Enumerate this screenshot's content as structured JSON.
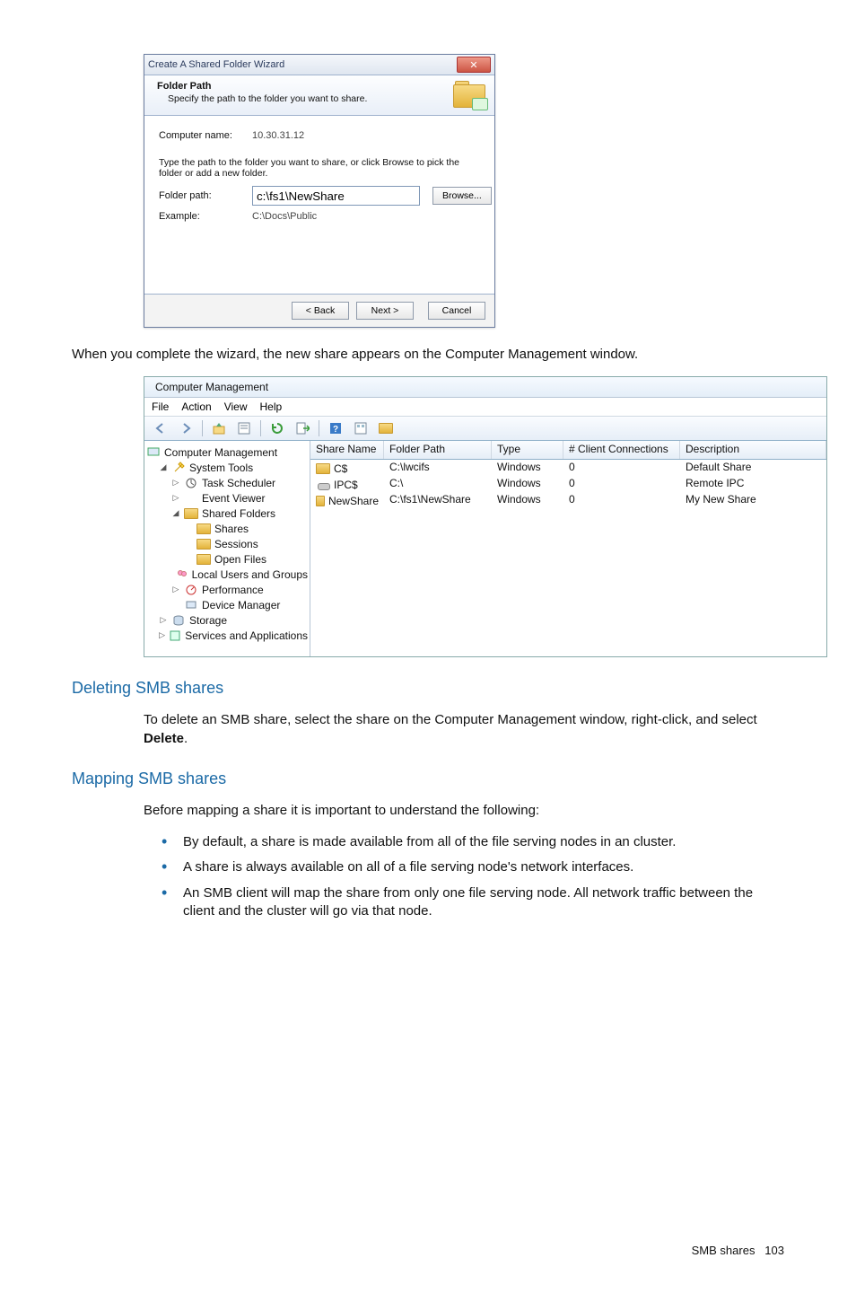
{
  "wizard": {
    "title": "Create A Shared Folder Wizard",
    "header_title": "Folder Path",
    "header_sub": "Specify the path to the folder you want to share.",
    "computer_label": "Computer name:",
    "computer_value": "10.30.31.12",
    "help": "Type the path to the folder you want to share, or click Browse to pick the folder or add a new folder.",
    "path_label": "Folder path:",
    "path_value": "c:\\fs1\\NewShare",
    "browse": "Browse...",
    "example_label": "Example:",
    "example_value": "C:\\Docs\\Public",
    "back": "< Back",
    "next": "Next >",
    "cancel": "Cancel"
  },
  "para_after_wizard": "When you complete the wizard, the new share appears on the Computer Management window.",
  "mgmt": {
    "title": "Computer Management",
    "menus": [
      "File",
      "Action",
      "View",
      "Help"
    ],
    "tree": {
      "root": "Computer Management",
      "system_tools": "System Tools",
      "task_scheduler": "Task Scheduler",
      "event_viewer": "Event Viewer",
      "shared_folders": "Shared Folders",
      "shares": "Shares",
      "sessions": "Sessions",
      "open_files": "Open Files",
      "local_users": "Local Users and Groups",
      "performance": "Performance",
      "device_manager": "Device Manager",
      "storage": "Storage",
      "services": "Services and Applications"
    },
    "columns": {
      "share": "Share Name",
      "path": "Folder Path",
      "type": "Type",
      "conn": "# Client Connections",
      "desc": "Description"
    },
    "rows": [
      {
        "share": "C$",
        "path": "C:\\lwcifs",
        "type": "Windows",
        "conn": "0",
        "desc": "Default Share"
      },
      {
        "share": "IPC$",
        "path": "C:\\",
        "type": "Windows",
        "conn": "0",
        "desc": "Remote IPC"
      },
      {
        "share": "NewShare",
        "path": "C:\\fs1\\NewShare",
        "type": "Windows",
        "conn": "0",
        "desc": "My New Share"
      }
    ]
  },
  "sec1": {
    "heading": "Deleting SMB shares",
    "para_pre": "To delete an SMB share, select the share on the Computer Management window, right-click, and select ",
    "para_bold": "Delete",
    "para_post": "."
  },
  "sec2": {
    "heading": "Mapping SMB shares",
    "intro": "Before mapping a share it is important to understand the following:",
    "bullets": [
      "By default, a share is made available from all of the file serving nodes in an cluster.",
      "A share is always available on all of a file serving node's network interfaces.",
      "An SMB client will map the share from only one file serving node. All network traffic between the client and the cluster will go via that node."
    ]
  },
  "footer": {
    "label": "SMB shares",
    "page": "103"
  }
}
